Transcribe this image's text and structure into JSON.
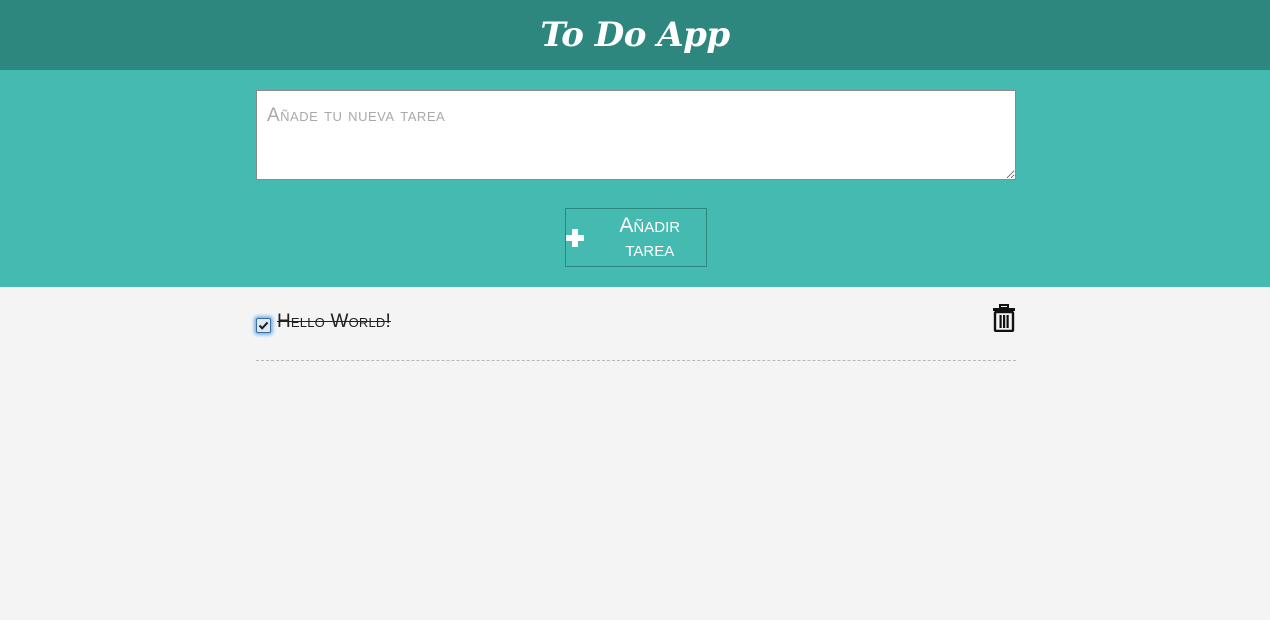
{
  "header": {
    "title": "To Do App"
  },
  "composer": {
    "placeholder": "Añade tu nueva tarea",
    "value": "",
    "add_button_label": "Añadir tarea",
    "add_icon": "plus-icon"
  },
  "tasks": [
    {
      "text": "Hello World!",
      "completed": true,
      "delete_icon": "trash-icon"
    }
  ],
  "colors": {
    "header_bg": "#2e877f",
    "band_bg": "#45bab0",
    "page_bg": "#f4f4f4"
  }
}
